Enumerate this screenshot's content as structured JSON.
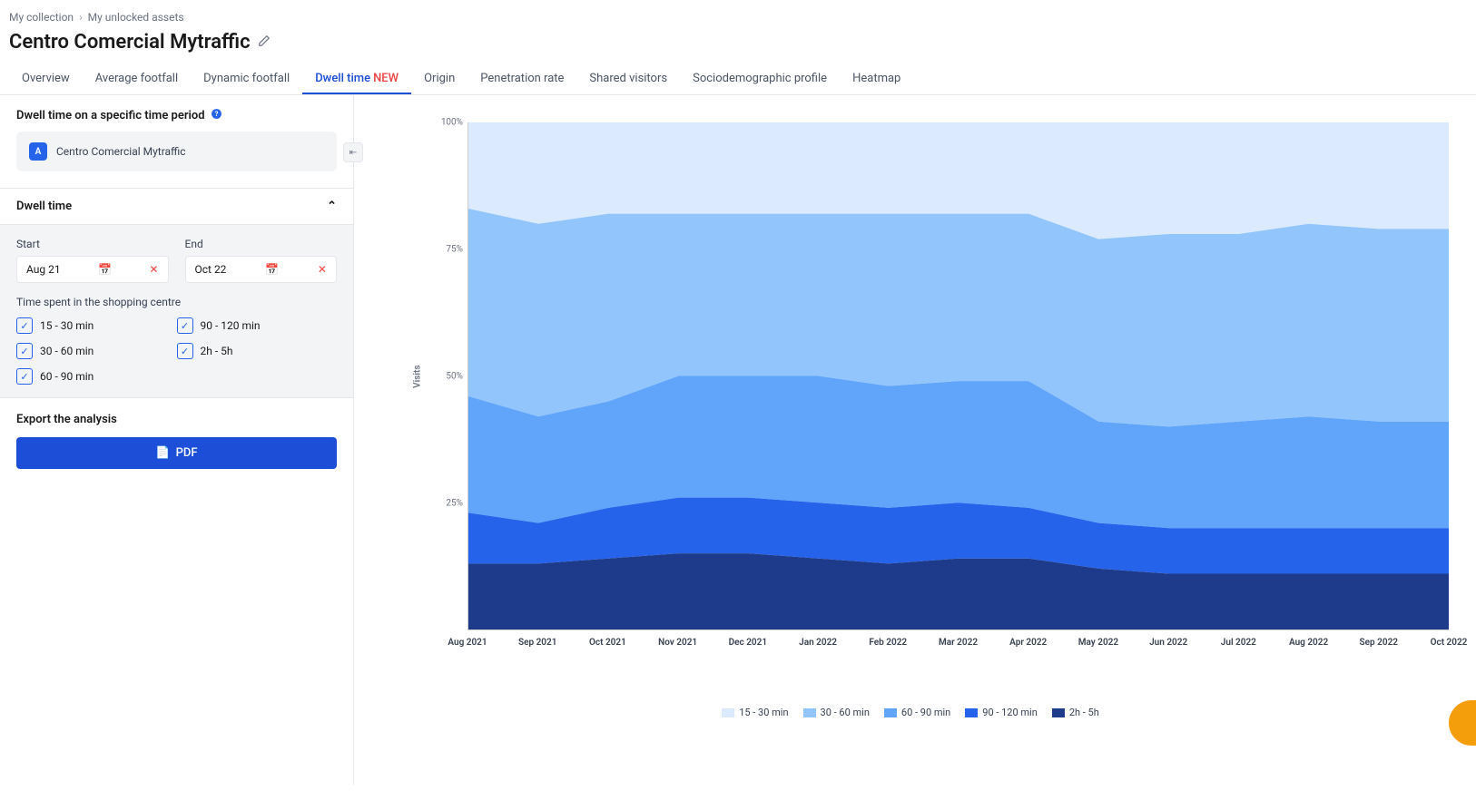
{
  "breadcrumb": {
    "a": "My collection",
    "b": "My unlocked assets"
  },
  "page_title": "Centro Comercial Mytraffic",
  "tabs": [
    {
      "label": "Overview"
    },
    {
      "label": "Average footfall"
    },
    {
      "label": "Dynamic footfall"
    },
    {
      "label": "Dwell time",
      "new": "NEW",
      "active": true
    },
    {
      "label": "Origin"
    },
    {
      "label": "Penetration rate"
    },
    {
      "label": "Shared visitors"
    },
    {
      "label": "Sociodemographic profile"
    },
    {
      "label": "Heatmap"
    }
  ],
  "section_title": "Dwell time on a specific time period",
  "asset": {
    "badge": "A",
    "name": "Centro Comercial Mytraffic"
  },
  "accordion_title": "Dwell time",
  "dates": {
    "start_label": "Start",
    "start_value": "Aug 21",
    "end_label": "End",
    "end_value": "Oct 22"
  },
  "time_spent_label": "Time spent in the shopping centre",
  "ranges": [
    "15 - 30 min",
    "30 - 60 min",
    "60 - 90 min",
    "90 - 120 min",
    "2h - 5h"
  ],
  "export": {
    "title": "Export the analysis",
    "btn": "PDF"
  },
  "chart_data": {
    "type": "area",
    "stacking": "percent",
    "title": "",
    "ylabel": "Visits",
    "ylim": [
      0,
      100
    ],
    "y_ticks": [
      "100%",
      "75%",
      "50%",
      "25%"
    ],
    "categories": [
      "Aug 2021",
      "Sep 2021",
      "Oct 2021",
      "Nov 2021",
      "Dec 2021",
      "Jan 2022",
      "Feb 2022",
      "Mar 2022",
      "Apr 2022",
      "May 2022",
      "Jun 2022",
      "Jul 2022",
      "Aug 2022",
      "Sep 2022",
      "Oct 2022"
    ],
    "series": [
      {
        "name": "15 - 30 min",
        "color": "#dbeafe",
        "values": [
          17,
          20,
          18,
          18,
          18,
          18,
          18,
          18,
          18,
          23,
          22,
          22,
          20,
          21,
          21
        ]
      },
      {
        "name": "30 - 60 min",
        "color": "#93c5fd",
        "values": [
          37,
          38,
          37,
          32,
          32,
          32,
          34,
          33,
          33,
          36,
          38,
          37,
          38,
          38,
          38
        ]
      },
      {
        "name": "60 - 90 min",
        "color": "#60a5fa",
        "values": [
          23,
          21,
          21,
          24,
          24,
          25,
          24,
          24,
          25,
          20,
          20,
          21,
          22,
          21,
          21
        ]
      },
      {
        "name": "90 - 120 min",
        "color": "#2563eb",
        "values": [
          10,
          8,
          10,
          11,
          11,
          11,
          11,
          11,
          10,
          9,
          9,
          9,
          9,
          9,
          9
        ]
      },
      {
        "name": "2h - 5h",
        "color": "#1e3a8a",
        "values": [
          13,
          13,
          14,
          15,
          15,
          14,
          13,
          14,
          14,
          12,
          11,
          11,
          11,
          11,
          11
        ]
      }
    ],
    "legend": [
      "15 - 30 min",
      "30 - 60 min",
      "60 - 90 min",
      "90 - 120 min",
      "2h - 5h"
    ],
    "legend_colors": [
      "#dbeafe",
      "#93c5fd",
      "#60a5fa",
      "#2563eb",
      "#1e3a8a"
    ]
  }
}
